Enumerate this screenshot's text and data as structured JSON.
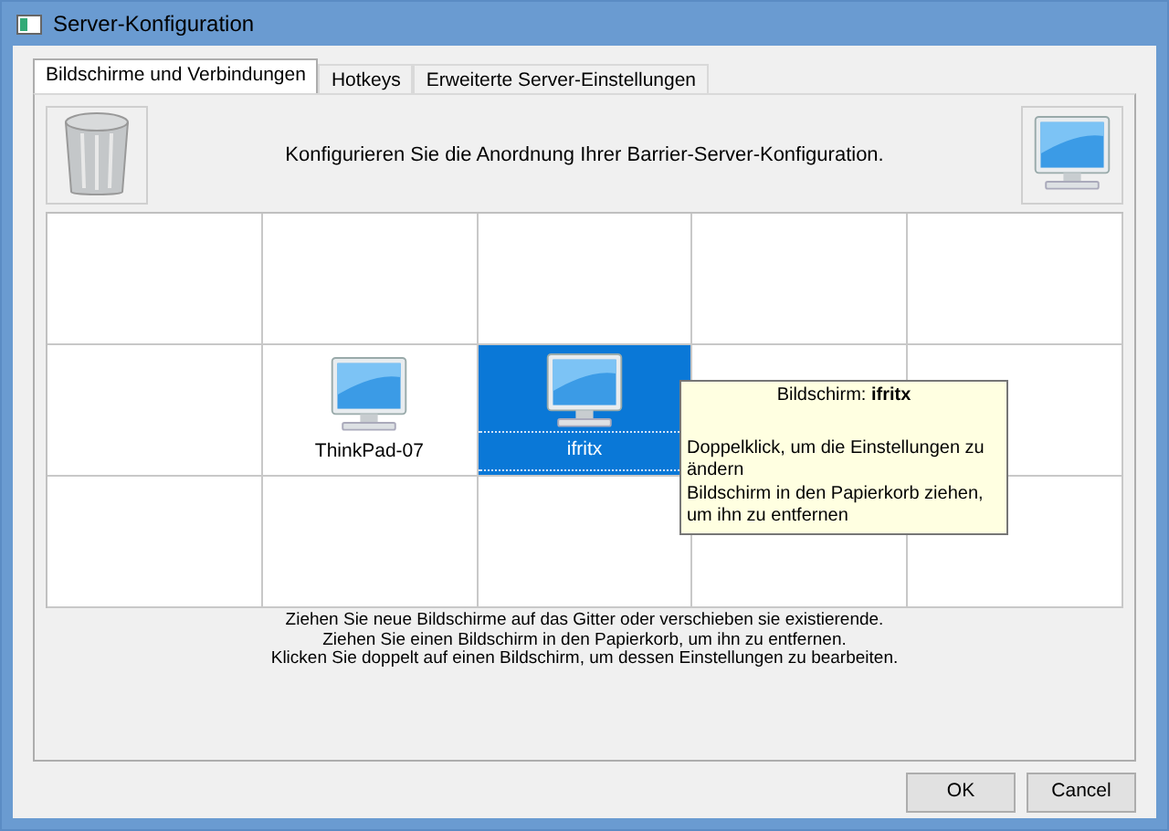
{
  "window": {
    "title": "Server-Konfiguration"
  },
  "tabs": [
    {
      "label": "Bildschirme und Verbindungen",
      "selected": true
    },
    {
      "label": "Hotkeys",
      "selected": false
    },
    {
      "label": "Erweiterte Server-Einstellungen",
      "selected": false
    }
  ],
  "header": {
    "text": "Konfigurieren Sie die Anordnung Ihrer Barrier-Server-Konfiguration."
  },
  "grid": {
    "rows": [
      [
        null,
        null,
        null,
        null,
        null
      ],
      [
        null,
        {
          "name": "ThinkPad-07",
          "selected": false
        },
        {
          "name": "ifritx",
          "selected": true
        },
        null,
        null
      ],
      [
        null,
        null,
        null,
        null,
        null
      ]
    ]
  },
  "tooltip": {
    "title": "Bildschirm: **ifritx**",
    "lines": [
      "Doppelklick, um die Einstellungen zu ändern",
      "Bildschirm in den Papierkorb ziehen, um ihn zu entfernen"
    ]
  },
  "instructions": [
    "Ziehen Sie neue Bildschirme auf das Gitter oder verschieben sie existierende.",
    "Ziehen Sie einen Bildschirm in den Papierkorb, um ihn zu entfernen.",
    "Klicken Sie doppelt auf einen Bildschirm, um dessen Einstellungen zu bearbeiten."
  ],
  "buttons": [
    "OK",
    "Cancel"
  ]
}
